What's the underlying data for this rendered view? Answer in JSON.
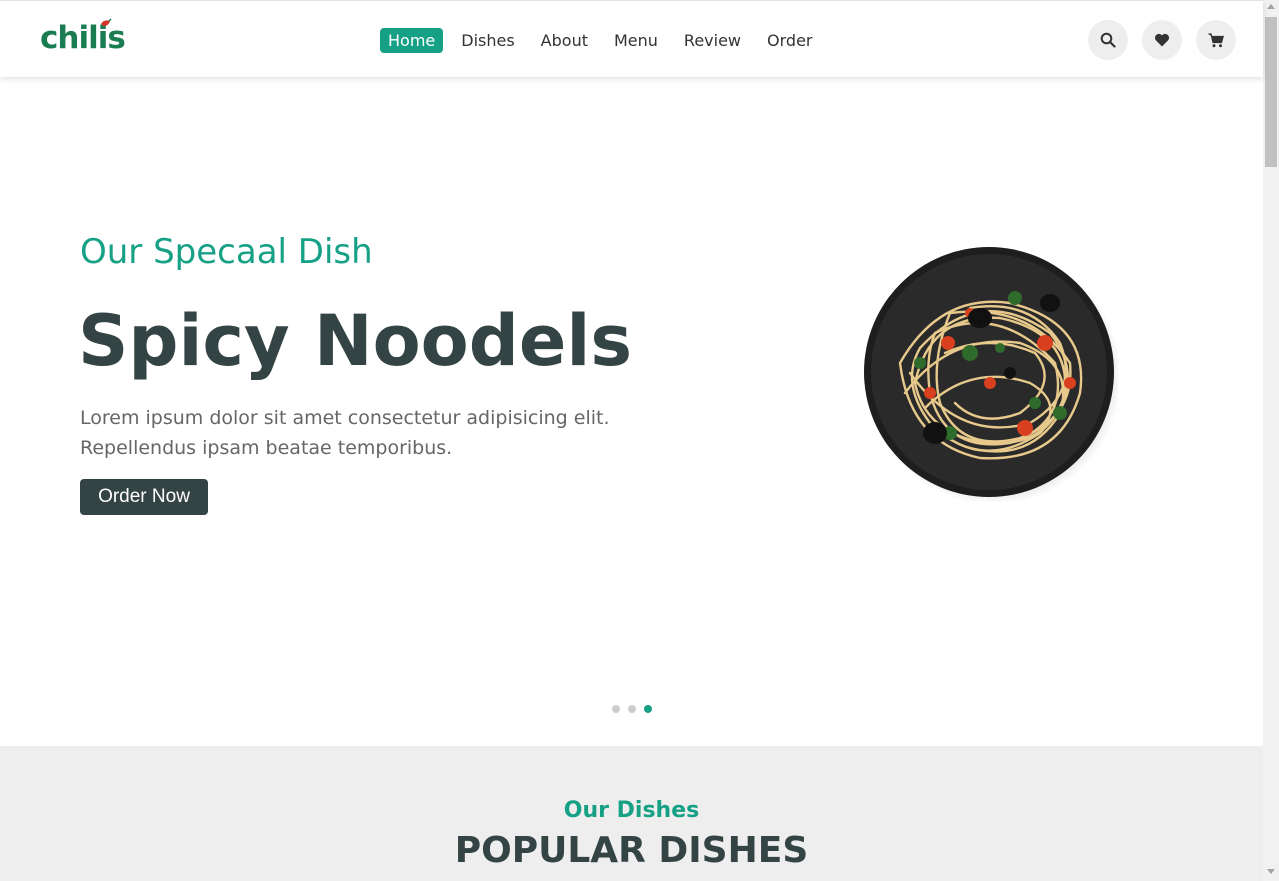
{
  "header": {
    "logo_text": "chilis",
    "nav": [
      {
        "label": "Home",
        "active": true
      },
      {
        "label": "Dishes",
        "active": false
      },
      {
        "label": "About",
        "active": false
      },
      {
        "label": "Menu",
        "active": false
      },
      {
        "label": "Review",
        "active": false
      },
      {
        "label": "Order",
        "active": false
      }
    ],
    "icons": [
      "search-icon",
      "heart-icon",
      "cart-icon"
    ]
  },
  "hero": {
    "subtitle": "Our Specaal Dish",
    "title": "Spicy Noodels",
    "description": "Lorem ipsum dolor sit amet consectetur adipisicing elit. Repellendus ipsam beatae temporibus.",
    "button_label": "Order Now",
    "slides_total": 3,
    "active_slide": 3
  },
  "section": {
    "subtitle": "Our Dishes",
    "title": "POPULAR DISHES"
  },
  "colors": {
    "accent": "#16a085",
    "dark": "#344344",
    "logo": "#1a7d52"
  }
}
